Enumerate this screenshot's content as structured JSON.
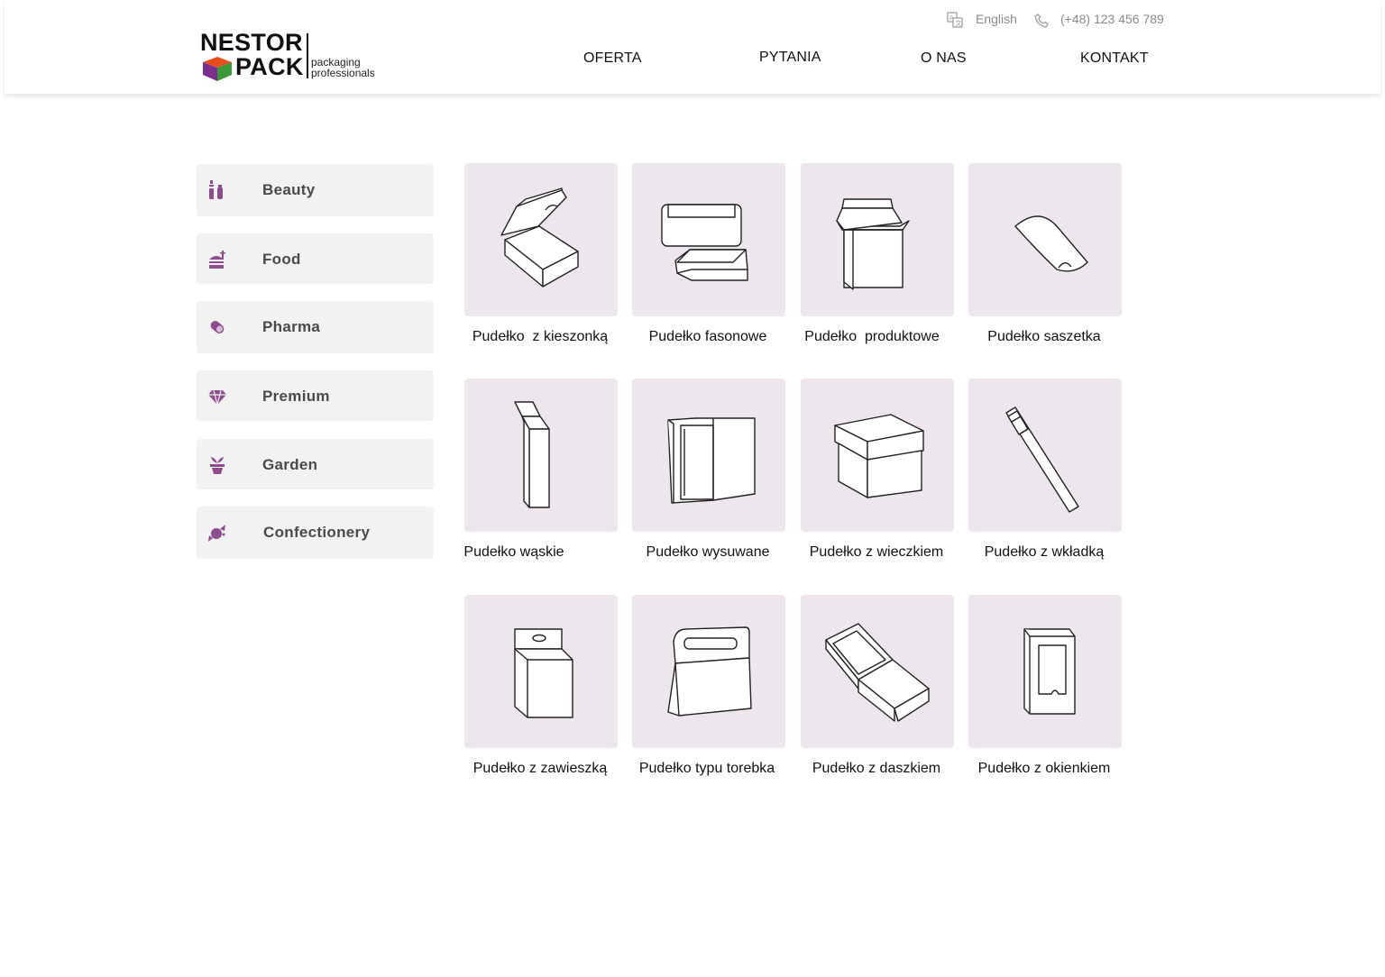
{
  "logo": {
    "line1": "NESTOR",
    "line2": "PACK",
    "tagline1": "packaging",
    "tagline2": "professionals"
  },
  "topbar": {
    "language": "English",
    "phone": "(+48) 123 456 789"
  },
  "nav": [
    {
      "label": "OFERTA"
    },
    {
      "label": "PYTANIA"
    },
    {
      "label": "O NAS"
    },
    {
      "label": "KONTAKT"
    }
  ],
  "sidebar": {
    "items": [
      {
        "label": "Beauty",
        "icon": "lipstick-icon"
      },
      {
        "label": "Food",
        "icon": "burger-icon"
      },
      {
        "label": "Pharma",
        "icon": "pill-icon"
      },
      {
        "label": "Premium",
        "icon": "diamond-icon"
      },
      {
        "label": "Garden",
        "icon": "plant-pot-icon"
      },
      {
        "label": "Confectionery",
        "icon": "candy-icon"
      }
    ]
  },
  "products": [
    {
      "label": "Pudełko  z kieszonką",
      "icon": "pocket-box-icon"
    },
    {
      "label": "Pudełko fasonowe",
      "icon": "shaped-box-icon"
    },
    {
      "label": "Pudełko  produktowe",
      "icon": "product-box-icon"
    },
    {
      "label": "Pudełko saszetka",
      "icon": "pillow-box-icon"
    },
    {
      "label": "Pudełko wąskie",
      "icon": "narrow-box-icon"
    },
    {
      "label": "Pudełko wysuwane",
      "icon": "sliding-box-icon"
    },
    {
      "label": "Pudełko z wieczkiem",
      "icon": "lid-box-icon"
    },
    {
      "label": "Pudełko z wkładką",
      "icon": "insert-box-icon"
    },
    {
      "label": "Pudełko z zawieszką",
      "icon": "hanger-box-icon"
    },
    {
      "label": "Pudełko typu torebka",
      "icon": "bag-box-icon"
    },
    {
      "label": "Pudełko z daszkiem",
      "icon": "roof-box-icon"
    },
    {
      "label": "Pudełko z okienkiem",
      "icon": "window-box-icon"
    }
  ],
  "colors": {
    "accent": "#8c4d8c",
    "sidebar_bg": "#f2f2f2",
    "card_bg": "#ede6ed",
    "topbar_text": "#8a8a8a"
  }
}
